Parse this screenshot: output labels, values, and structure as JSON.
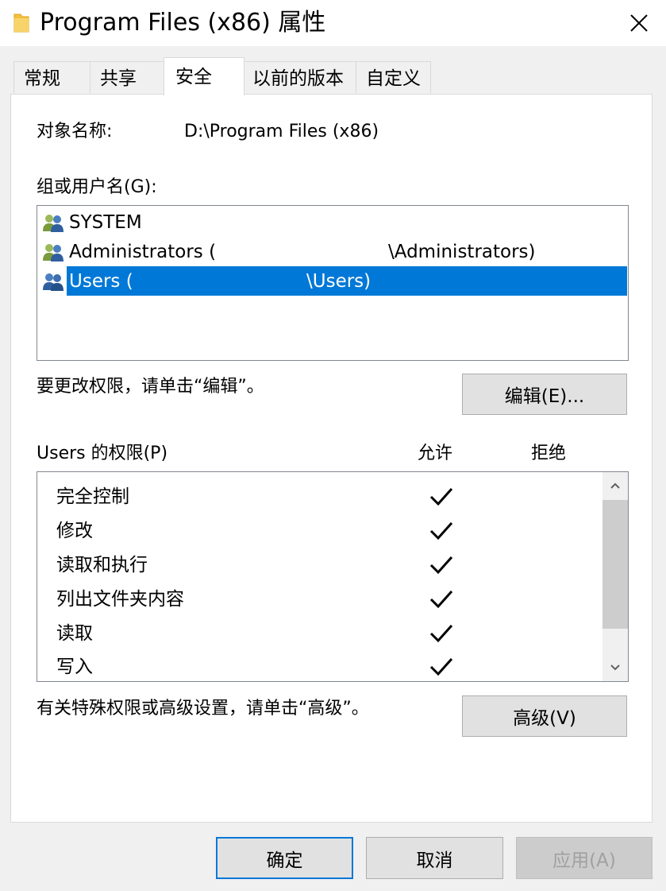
{
  "window": {
    "title": "Program Files (x86) 属性",
    "folder_color": "#f7c948"
  },
  "tabs": [
    {
      "label": "常规",
      "active": false
    },
    {
      "label": "共享",
      "active": false
    },
    {
      "label": "安全",
      "active": true
    },
    {
      "label": "以前的版本",
      "active": false
    },
    {
      "label": "自定义",
      "active": false
    }
  ],
  "object": {
    "label": "对象名称:",
    "value": "D:\\Program Files (x86)"
  },
  "groups": {
    "label": "组或用户名(G):",
    "items": [
      {
        "prefix": "SYSTEM",
        "suffix": "",
        "selected": false
      },
      {
        "prefix": "Administrators (",
        "suffix": "\\Administrators)",
        "selected": false
      },
      {
        "prefix": "Users (",
        "suffix": "\\Users)",
        "selected": true
      }
    ]
  },
  "edit": {
    "hint": "要更改权限，请单击“编辑”。",
    "button": "编辑(E)..."
  },
  "permissions": {
    "title": "Users 的权限(P)",
    "allow_header": "允许",
    "deny_header": "拒绝",
    "items": [
      {
        "name": "完全控制",
        "allow": true,
        "deny": false
      },
      {
        "name": "修改",
        "allow": true,
        "deny": false
      },
      {
        "name": "读取和执行",
        "allow": true,
        "deny": false
      },
      {
        "name": "列出文件夹内容",
        "allow": true,
        "deny": false
      },
      {
        "name": "读取",
        "allow": true,
        "deny": false
      },
      {
        "name": "写入",
        "allow": true,
        "deny": false
      }
    ]
  },
  "advanced": {
    "hint": "有关特殊权限或高级设置，请单击“高级”。",
    "button": "高级(V)"
  },
  "footer": {
    "ok": "确定",
    "cancel": "取消",
    "apply": "应用(A)"
  },
  "colors": {
    "selection": "#0078d7",
    "default_button_border": "#0078d7"
  }
}
